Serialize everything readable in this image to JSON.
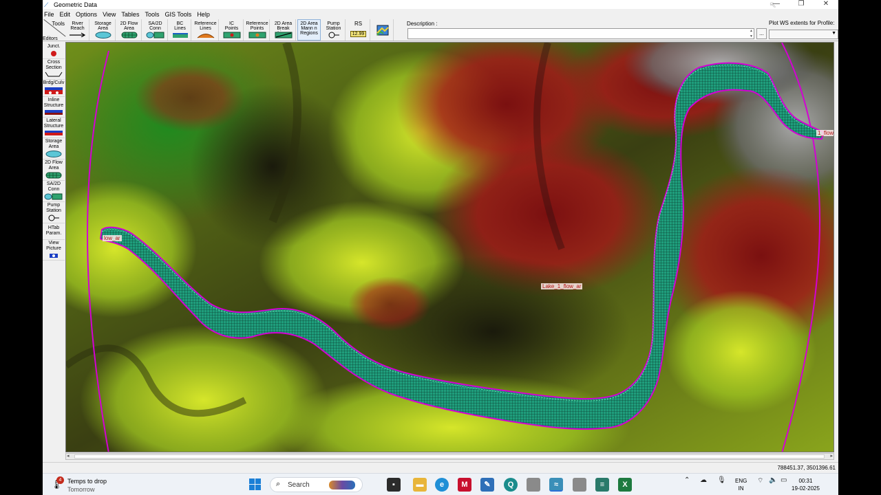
{
  "window": {
    "title": "Geometric Data",
    "minimize": "—",
    "maximize": "❐",
    "close": "✕"
  },
  "menu": [
    "File",
    "Edit",
    "Options",
    "View",
    "Tables",
    "Tools",
    "GIS Tools",
    "Help"
  ],
  "toolbar": {
    "tools_label": "Tools",
    "editors_label": "Editors",
    "buttons": [
      {
        "label": "River\nReach",
        "icon": "river-reach-icon"
      },
      {
        "label": "Storage\nArea",
        "icon": "storage-area-icon"
      },
      {
        "label": "2D Flow\nArea",
        "icon": "2d-flow-area-icon"
      },
      {
        "label": "SA/2D\nConn",
        "icon": "sa-2d-conn-icon"
      },
      {
        "label": "BC\nLines",
        "icon": "bc-lines-icon"
      },
      {
        "label": "Reference\nLines",
        "icon": "reference-lines-icon"
      },
      {
        "label": "IC\nPoints",
        "icon": "ic-points-icon"
      },
      {
        "label": "Reference\nPoints",
        "icon": "reference-points-icon"
      },
      {
        "label": "2D Area\nBreak Lines",
        "icon": "break-lines-icon"
      },
      {
        "label": "2D Area\nMann n\nRegions",
        "icon": "mann-regions-icon"
      },
      {
        "label": "Pump\nStation",
        "icon": "pump-station-icon"
      },
      {
        "label": "RS",
        "icon": "rs-icon",
        "value": "12.99"
      },
      {
        "label": "",
        "icon": "map-layers-icon"
      }
    ],
    "description_label": "Description :",
    "description_value": "",
    "description_button": "...",
    "plot_ws_label": "Plot WS extents for Profile:",
    "plot_ws_value": ""
  },
  "editors": [
    {
      "label": "Junct.",
      "icon": "junction-icon"
    },
    {
      "label": "Cross\nSection",
      "icon": "cross-section-icon"
    },
    {
      "label": "Brdg/Culv",
      "icon": "bridge-culvert-icon"
    },
    {
      "label": "Inline\nStructure",
      "icon": "inline-structure-icon"
    },
    {
      "label": "Lateral\nStructure",
      "icon": "lateral-structure-icon"
    },
    {
      "label": "Storage\nArea",
      "icon": "storage-area-icon"
    },
    {
      "label": "2D Flow\nArea",
      "icon": "2d-flow-area-icon"
    },
    {
      "label": "SA/2D\nConn",
      "icon": "sa-2d-conn-icon"
    },
    {
      "label": "Pump\nStation",
      "icon": "pump-station-icon"
    },
    {
      "label": "HTab\nParam.",
      "icon": "htab-icon"
    },
    {
      "label": "View\nPicture",
      "icon": "camera-icon"
    }
  ],
  "map": {
    "labels": {
      "center": "Lake_1_flow_ar",
      "right": "1_flow_ar",
      "left": "low_ar"
    },
    "colors": {
      "flow_area_fill": "#1f9e7c",
      "flow_area_mesh": "#7ef2c8",
      "boundary": "#d400d4"
    }
  },
  "status": {
    "coordinates": "788451.37, 3501396.61"
  },
  "taskbar": {
    "weather_title": "Temps to drop",
    "weather_sub": "Tomorrow",
    "weather_badge": "4",
    "search_placeholder": "Search",
    "lang_line1": "ENG",
    "lang_line2": "IN",
    "time": "00:31",
    "date": "19-02-2025"
  }
}
